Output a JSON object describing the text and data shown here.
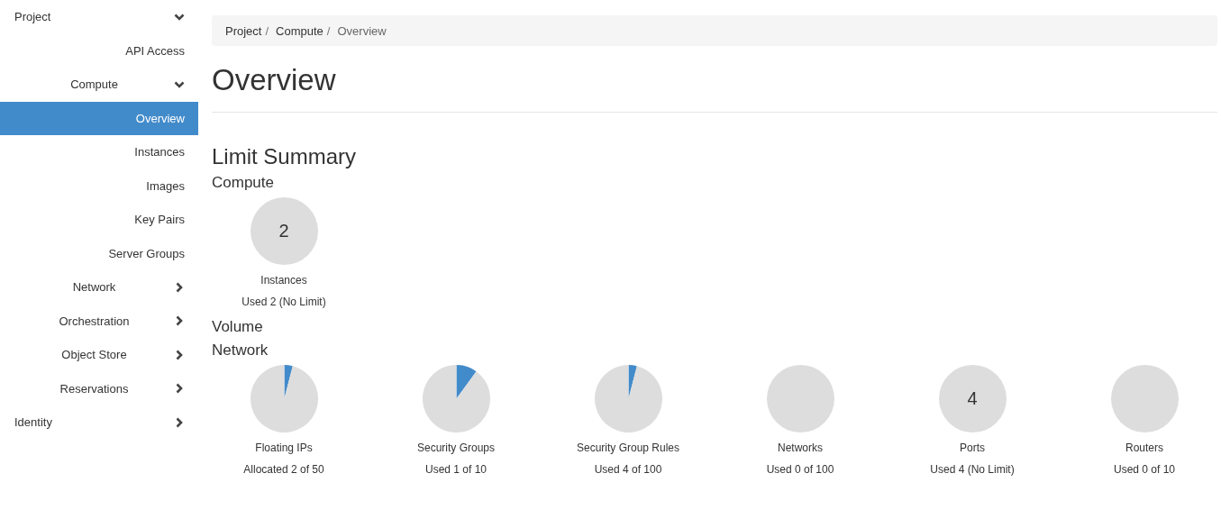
{
  "sidebar": {
    "items": [
      {
        "kind": "group",
        "label": "Project",
        "expanded": true,
        "children": [
          {
            "kind": "link",
            "label": "API Access",
            "selected": false
          },
          {
            "kind": "group",
            "label": "Compute",
            "expanded": true,
            "children": [
              {
                "kind": "link",
                "label": "Overview",
                "selected": true
              },
              {
                "kind": "link",
                "label": "Instances",
                "selected": false
              },
              {
                "kind": "link",
                "label": "Images",
                "selected": false
              },
              {
                "kind": "link",
                "label": "Key Pairs",
                "selected": false
              },
              {
                "kind": "link",
                "label": "Server Groups",
                "selected": false
              }
            ]
          },
          {
            "kind": "group",
            "label": "Network",
            "expanded": false
          },
          {
            "kind": "group",
            "label": "Orchestration",
            "expanded": false
          },
          {
            "kind": "group",
            "label": "Object Store",
            "expanded": false
          },
          {
            "kind": "group",
            "label": "Reservations",
            "expanded": false
          }
        ]
      },
      {
        "kind": "group",
        "label": "Identity",
        "expanded": false
      }
    ]
  },
  "breadcrumb": {
    "separator": "/",
    "items": [
      "Project",
      "Compute",
      "Overview"
    ]
  },
  "page_title": "Overview",
  "limit_summary": {
    "title": "Limit Summary",
    "sections": [
      {
        "title": "Compute",
        "charts": [
          {
            "kind": "count",
            "value": "2",
            "label": "Instances",
            "usage": "Used 2 (No Limit)"
          }
        ]
      },
      {
        "title": "Volume"
      },
      {
        "title": "Network",
        "charts": [
          {
            "kind": "pie",
            "chart_data": {
              "type": "pie",
              "values": [
                4,
                96
              ]
            },
            "label": "Floating IPs",
            "usage": "Allocated 2 of 50"
          },
          {
            "kind": "pie",
            "chart_data": {
              "type": "pie",
              "values": [
                10,
                90
              ]
            },
            "label": "Security Groups",
            "usage": "Used 1 of 10"
          },
          {
            "kind": "pie",
            "chart_data": {
              "type": "pie",
              "values": [
                4,
                96
              ]
            },
            "label": "Security Group Rules",
            "usage": "Used 4 of 100"
          },
          {
            "kind": "blank",
            "label": "Networks",
            "usage": "Used 0 of 100"
          },
          {
            "kind": "count",
            "value": "4",
            "label": "Ports",
            "usage": "Used 4 (No Limit)"
          },
          {
            "kind": "blank",
            "label": "Routers",
            "usage": "Used 0 of 10"
          }
        ]
      }
    ]
  }
}
